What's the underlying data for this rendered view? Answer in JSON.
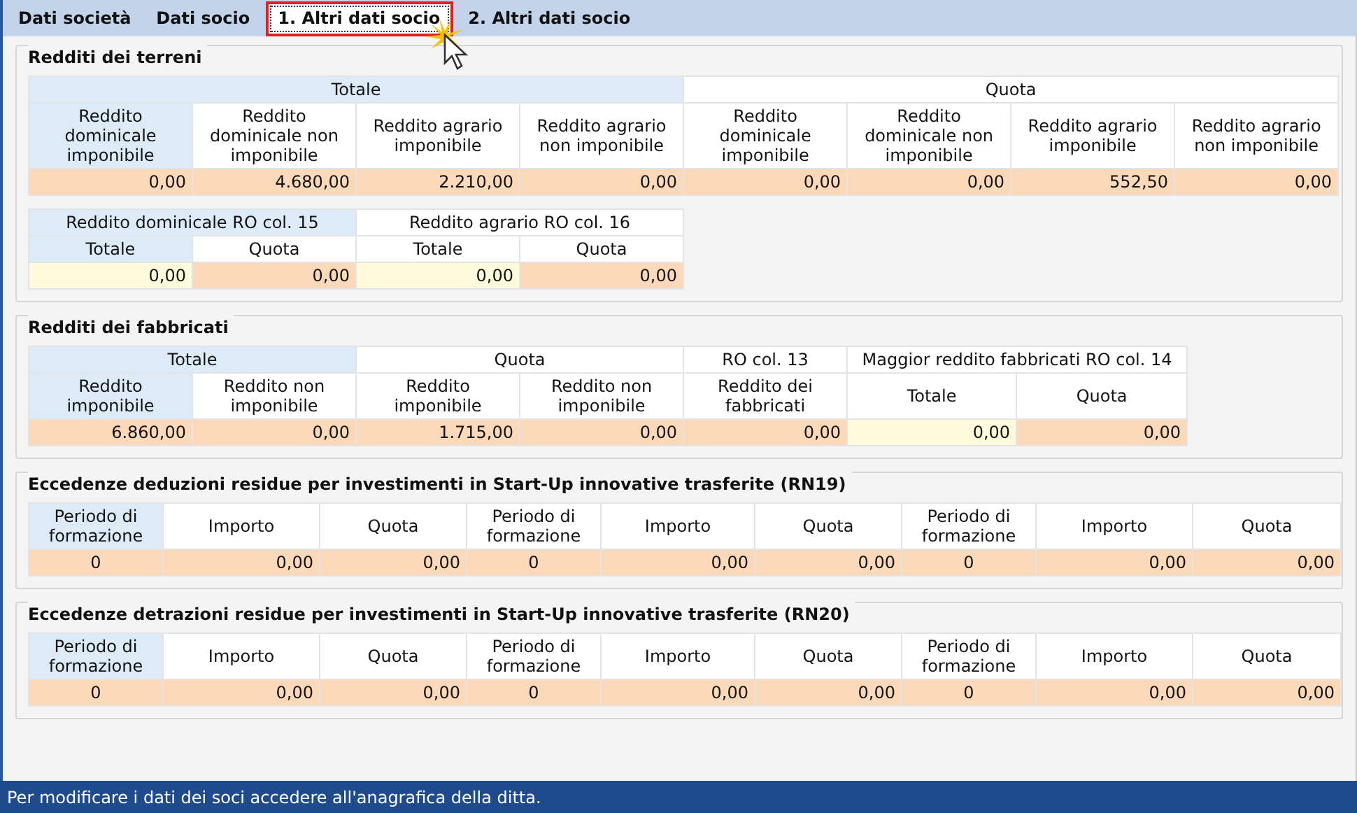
{
  "tabs": [
    {
      "label": "Dati società",
      "selected": false
    },
    {
      "label": "Dati socio",
      "selected": false
    },
    {
      "label": "1. Altri dati socio",
      "selected": true
    },
    {
      "label": "2. Altri dati socio",
      "selected": false
    }
  ],
  "sections": [
    {
      "title": "Redditi dei terreni",
      "tables": [
        {
          "groups": [
            {
              "text": "Totale",
              "shaded": true,
              "columns": [
                {
                  "text": "Reddito dominicale imponibile",
                  "shaded": true
                },
                {
                  "text": "Reddito dominicale non imponibile",
                  "shaded": false
                },
                {
                  "text": "Reddito agrario imponibile",
                  "shaded": false
                },
                {
                  "text": "Reddito agrario non imponibile",
                  "shaded": false
                }
              ]
            },
            {
              "text": "Quota",
              "shaded": false,
              "columns": [
                {
                  "text": "Reddito dominicale imponibile",
                  "shaded": false
                },
                {
                  "text": "Reddito dominicale non imponibile",
                  "shaded": false
                },
                {
                  "text": "Reddito agrario imponibile",
                  "shaded": false
                },
                {
                  "text": "Reddito agrario non imponibile",
                  "shaded": false
                }
              ]
            }
          ],
          "values": [
            {
              "value": "0,00",
              "kind": "calc"
            },
            {
              "value": "4.680,00",
              "kind": "calc"
            },
            {
              "value": "2.210,00",
              "kind": "calc"
            },
            {
              "value": "0,00",
              "kind": "calc"
            },
            {
              "value": "0,00",
              "kind": "calc"
            },
            {
              "value": "0,00",
              "kind": "calc"
            },
            {
              "value": "552,50",
              "kind": "calc"
            },
            {
              "value": "0,00",
              "kind": "calc"
            }
          ]
        },
        {
          "groups": [
            {
              "text": "Reddito dominicale RO col. 15",
              "shaded": true,
              "columns": [
                {
                  "text": "Totale",
                  "shaded": true
                },
                {
                  "text": "Quota",
                  "shaded": false
                }
              ]
            },
            {
              "text": "Reddito agrario RO col. 16",
              "shaded": false,
              "columns": [
                {
                  "text": "Totale",
                  "shaded": false
                },
                {
                  "text": "Quota",
                  "shaded": false
                }
              ]
            }
          ],
          "values": [
            {
              "value": "0,00",
              "kind": "input"
            },
            {
              "value": "0,00",
              "kind": "calc"
            },
            {
              "value": "0,00",
              "kind": "input"
            },
            {
              "value": "0,00",
              "kind": "calc"
            }
          ]
        }
      ]
    },
    {
      "title": "Redditi dei fabbricati",
      "tables": [
        {
          "groups": [
            {
              "text": "Totale",
              "shaded": true,
              "columns": [
                {
                  "text": "Reddito imponibile",
                  "shaded": true
                },
                {
                  "text": "Reddito non imponibile",
                  "shaded": false
                }
              ]
            },
            {
              "text": "Quota",
              "shaded": false,
              "columns": [
                {
                  "text": "Reddito imponibile",
                  "shaded": false
                },
                {
                  "text": "Reddito non imponibile",
                  "shaded": false
                }
              ]
            },
            {
              "text": "RO col. 13",
              "shaded": false,
              "columns": [
                {
                  "text": "Reddito dei fabbricati",
                  "shaded": false
                }
              ]
            },
            {
              "text": "Maggior reddito fabbricati RO col. 14",
              "shaded": false,
              "columns": [
                {
                  "text": "Totale",
                  "shaded": false
                },
                {
                  "text": "Quota",
                  "shaded": false
                }
              ]
            }
          ],
          "values": [
            {
              "value": "6.860,00",
              "kind": "calc"
            },
            {
              "value": "0,00",
              "kind": "calc"
            },
            {
              "value": "1.715,00",
              "kind": "calc"
            },
            {
              "value": "0,00",
              "kind": "calc"
            },
            {
              "value": "0,00",
              "kind": "calc"
            },
            {
              "value": "0,00",
              "kind": "input"
            },
            {
              "value": "0,00",
              "kind": "calc"
            }
          ]
        }
      ]
    },
    {
      "title": "Eccedenze deduzioni residue per investimenti in Start-Up innovative trasferite (RN19)",
      "tables": [
        {
          "columns": [
            {
              "text": "Periodo di formazione",
              "shaded": true
            },
            {
              "text": "Importo",
              "shaded": false
            },
            {
              "text": "Quota",
              "shaded": false
            },
            {
              "text": "Periodo di formazione",
              "shaded": false
            },
            {
              "text": "Importo",
              "shaded": false
            },
            {
              "text": "Quota",
              "shaded": false
            },
            {
              "text": "Periodo di formazione",
              "shaded": false
            },
            {
              "text": "Importo",
              "shaded": false
            },
            {
              "text": "Quota",
              "shaded": false
            }
          ],
          "values": [
            {
              "value": "0",
              "kind": "period"
            },
            {
              "value": "0,00",
              "kind": "calc"
            },
            {
              "value": "0,00",
              "kind": "calc"
            },
            {
              "value": "0",
              "kind": "period"
            },
            {
              "value": "0,00",
              "kind": "calc"
            },
            {
              "value": "0,00",
              "kind": "calc"
            },
            {
              "value": "0",
              "kind": "period"
            },
            {
              "value": "0,00",
              "kind": "calc"
            },
            {
              "value": "0,00",
              "kind": "calc"
            }
          ]
        }
      ]
    },
    {
      "title": "Eccedenze detrazioni residue per investimenti in Start-Up innovative trasferite (RN20)",
      "tables": [
        {
          "columns": [
            {
              "text": "Periodo di formazione",
              "shaded": true
            },
            {
              "text": "Importo",
              "shaded": false
            },
            {
              "text": "Quota",
              "shaded": false
            },
            {
              "text": "Periodo di formazione",
              "shaded": false
            },
            {
              "text": "Importo",
              "shaded": false
            },
            {
              "text": "Quota",
              "shaded": false
            },
            {
              "text": "Periodo di formazione",
              "shaded": false
            },
            {
              "text": "Importo",
              "shaded": false
            },
            {
              "text": "Quota",
              "shaded": false
            }
          ],
          "values": [
            {
              "value": "0",
              "kind": "period"
            },
            {
              "value": "0,00",
              "kind": "calc"
            },
            {
              "value": "0,00",
              "kind": "calc"
            },
            {
              "value": "0",
              "kind": "period"
            },
            {
              "value": "0,00",
              "kind": "calc"
            },
            {
              "value": "0,00",
              "kind": "calc"
            },
            {
              "value": "0",
              "kind": "period"
            },
            {
              "value": "0,00",
              "kind": "calc"
            },
            {
              "value": "0,00",
              "kind": "calc"
            }
          ]
        }
      ]
    }
  ],
  "status_bar": "Per modificare i dati dei soci accedere all'anagrafica della ditta."
}
